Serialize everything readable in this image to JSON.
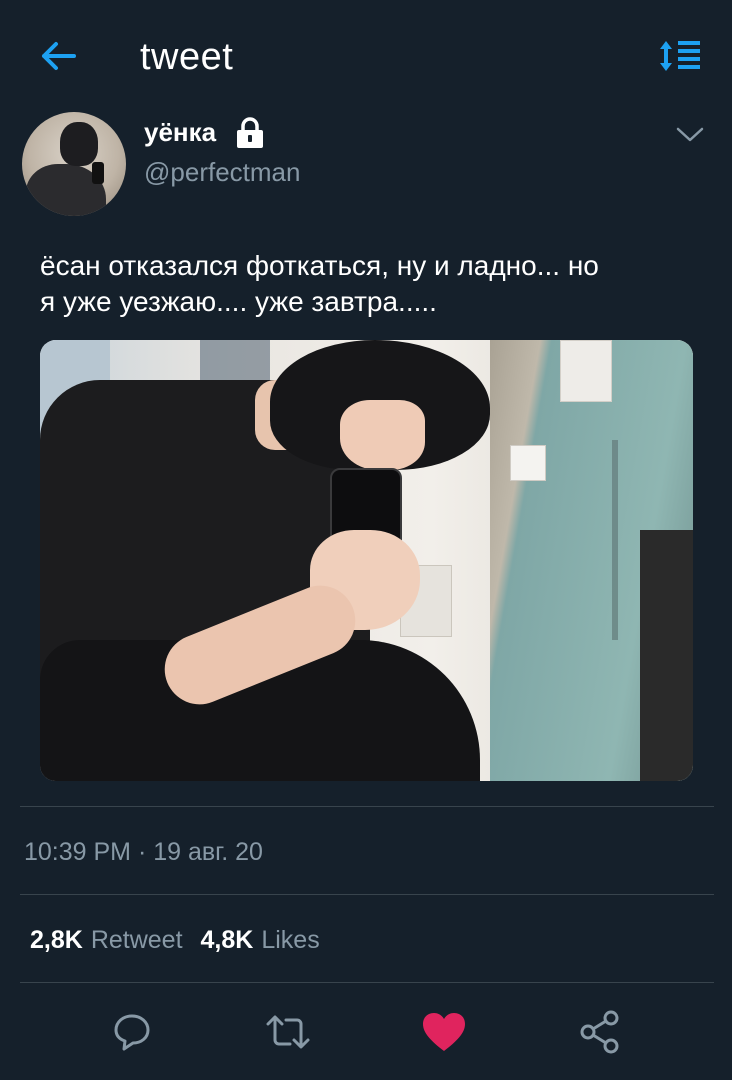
{
  "header": {
    "title": "tweet",
    "back_icon": "arrow-left-icon",
    "sort_icon": "sort-list-icon",
    "accent_color": "#1da1f2"
  },
  "tweet": {
    "display_name": "уёнка",
    "handle": "@perfectman",
    "protected_icon": "lock-icon",
    "text_line1": "ёсан отказался фоткаться, ну и ладно... но",
    "text_line2": "я уже уезжаю.... уже завтра.....",
    "media": "photo",
    "timestamp": "10:39 PM · 19 авг. 20"
  },
  "stats": {
    "retweets_count": "2,8K",
    "retweets_label": "Retweet",
    "likes_count": "4,8K",
    "likes_label": "Likes"
  },
  "actions": [
    {
      "icon": "reply-icon"
    },
    {
      "icon": "retweet-icon"
    },
    {
      "icon": "heart-icon",
      "active": true,
      "color": "#e0245e"
    },
    {
      "icon": "share-icon"
    }
  ],
  "colors": {
    "background": "#15202b",
    "secondary_text": "#8899a6",
    "divider": "#38444d"
  }
}
